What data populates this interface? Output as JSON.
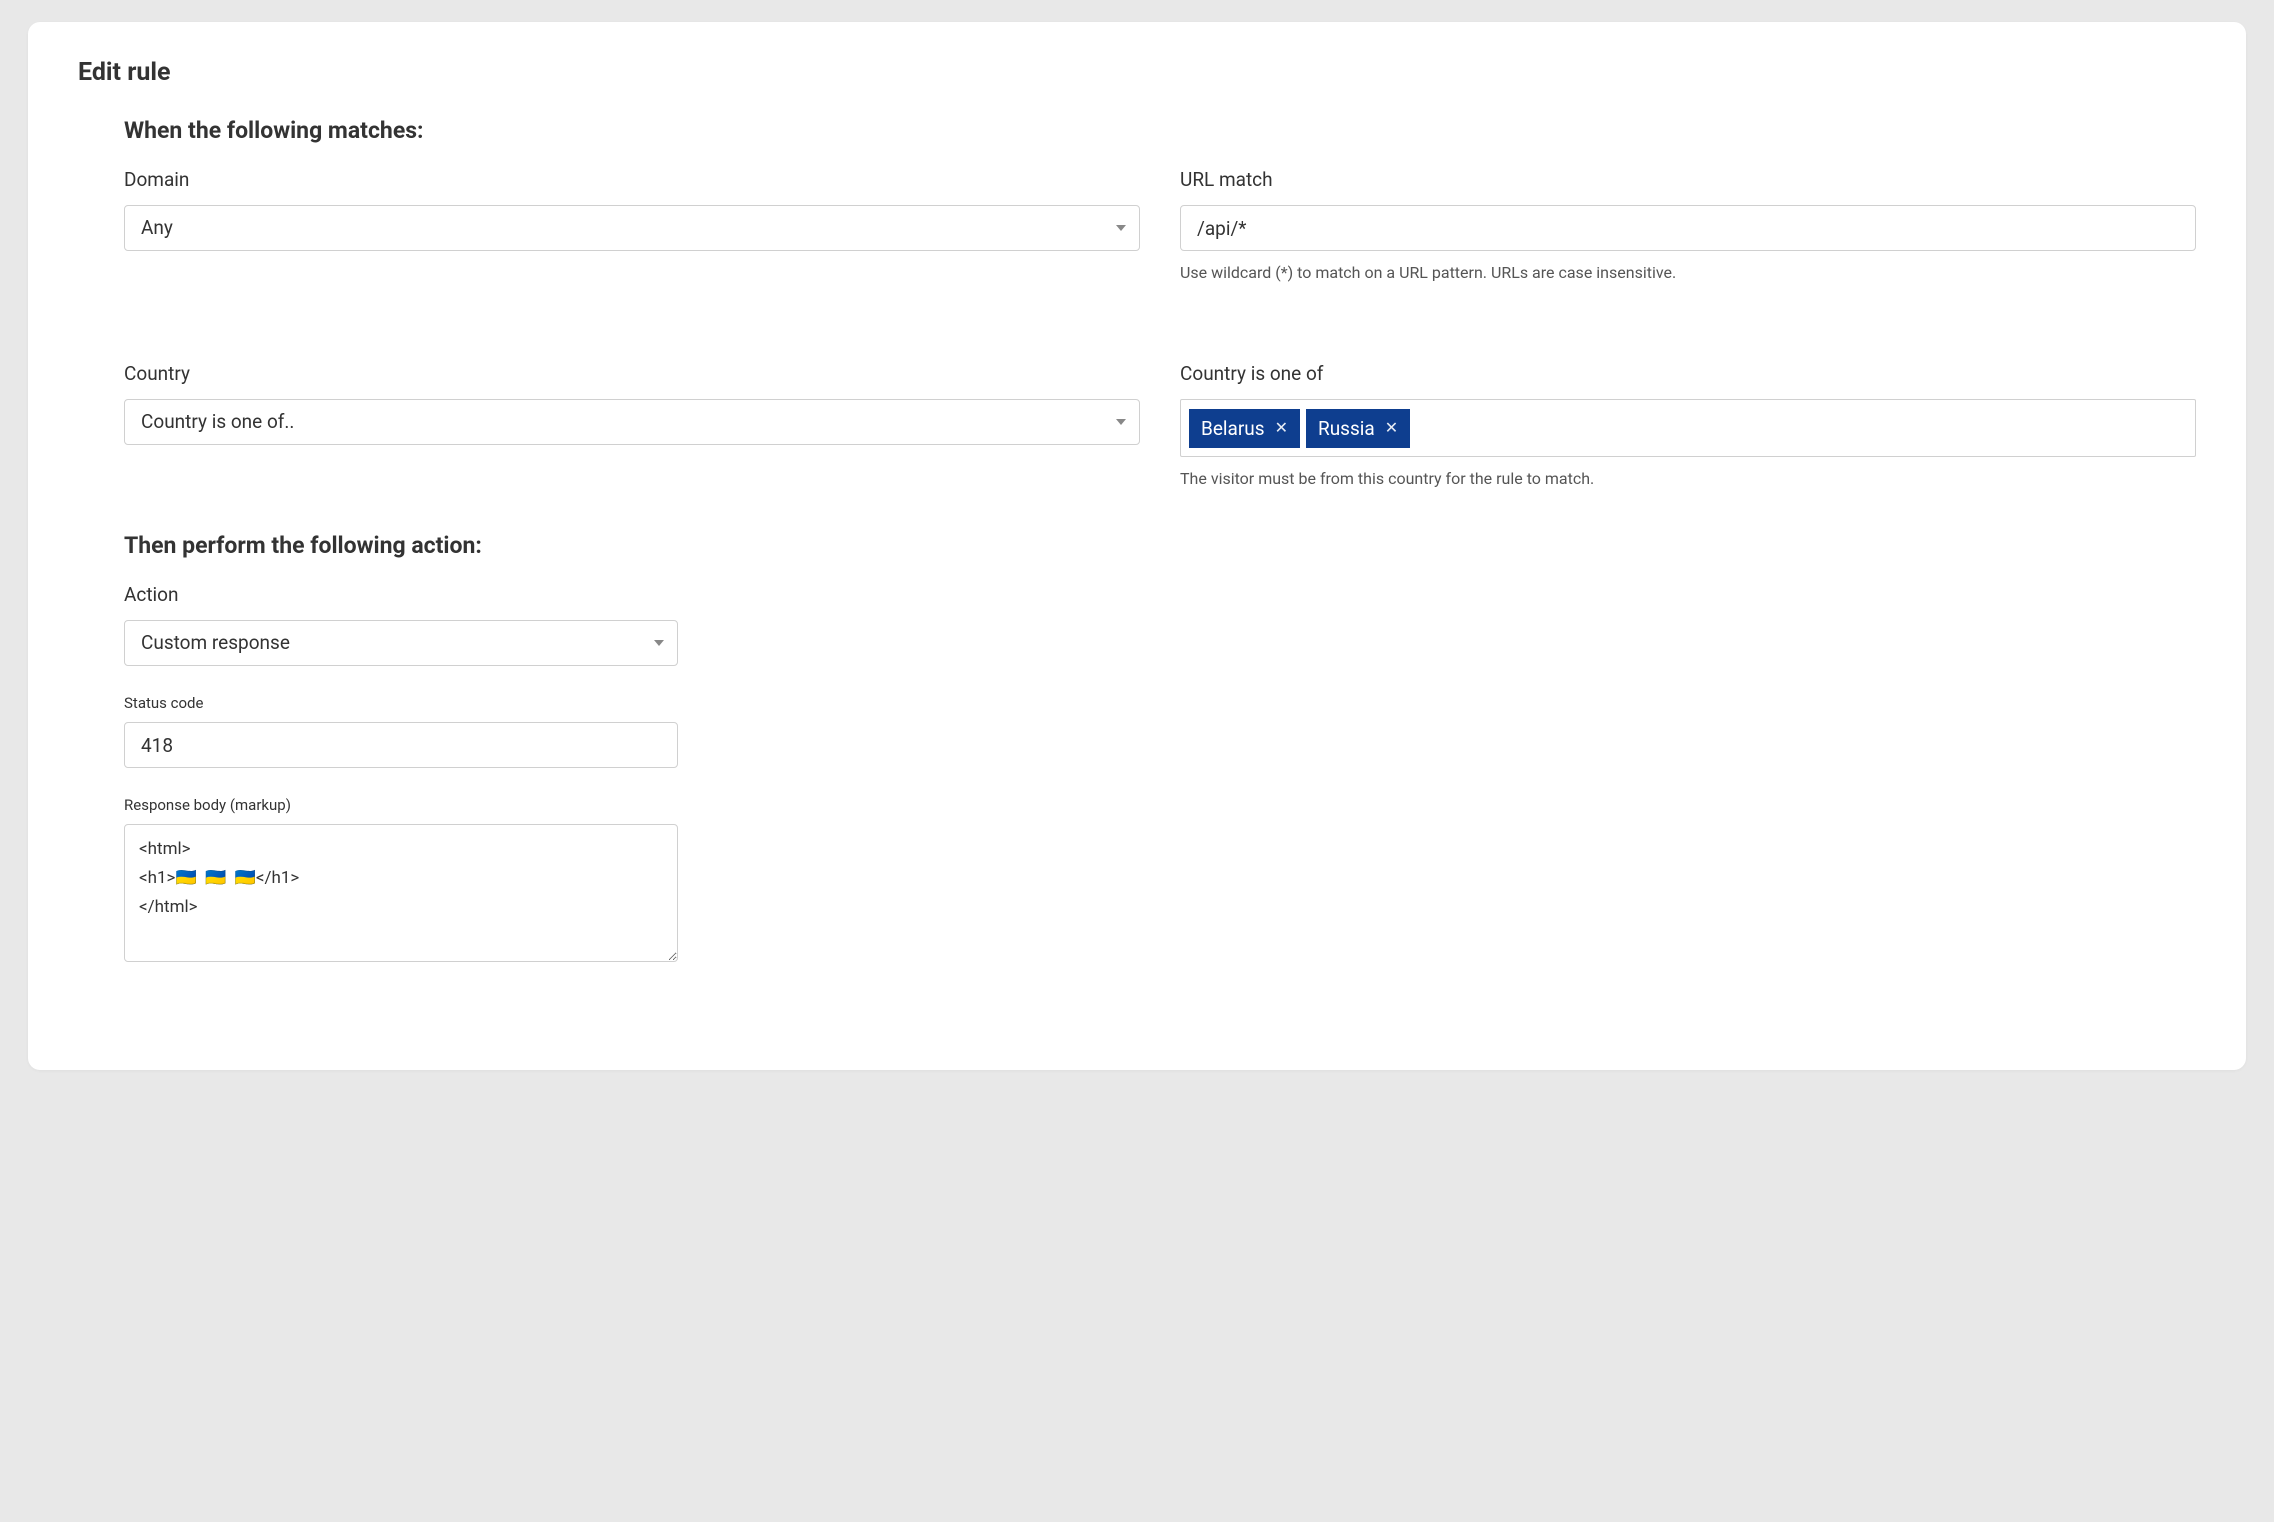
{
  "title": "Edit rule",
  "sections": {
    "match": {
      "heading": "When the following matches:",
      "domain": {
        "label": "Domain",
        "value": "Any"
      },
      "urlmatch": {
        "label": "URL match",
        "value": "/api/*",
        "help": "Use wildcard (*) to match on a URL pattern. URLs are case insensitive."
      },
      "country_mode": {
        "label": "Country",
        "value": "Country is one of.."
      },
      "country_values": {
        "label": "Country is one of",
        "tags": [
          "Belarus",
          "Russia"
        ],
        "help": "The visitor must be from this country for the rule to match."
      }
    },
    "action": {
      "heading": "Then perform the following action:",
      "action_select": {
        "label": "Action",
        "value": "Custom response"
      },
      "status_code": {
        "label": "Status code",
        "value": "418"
      },
      "response_body": {
        "label": "Response body (markup)",
        "value": "<html>\n<h1>🇺🇦  🇺🇦  🇺🇦</h1>\n</html>"
      }
    }
  }
}
